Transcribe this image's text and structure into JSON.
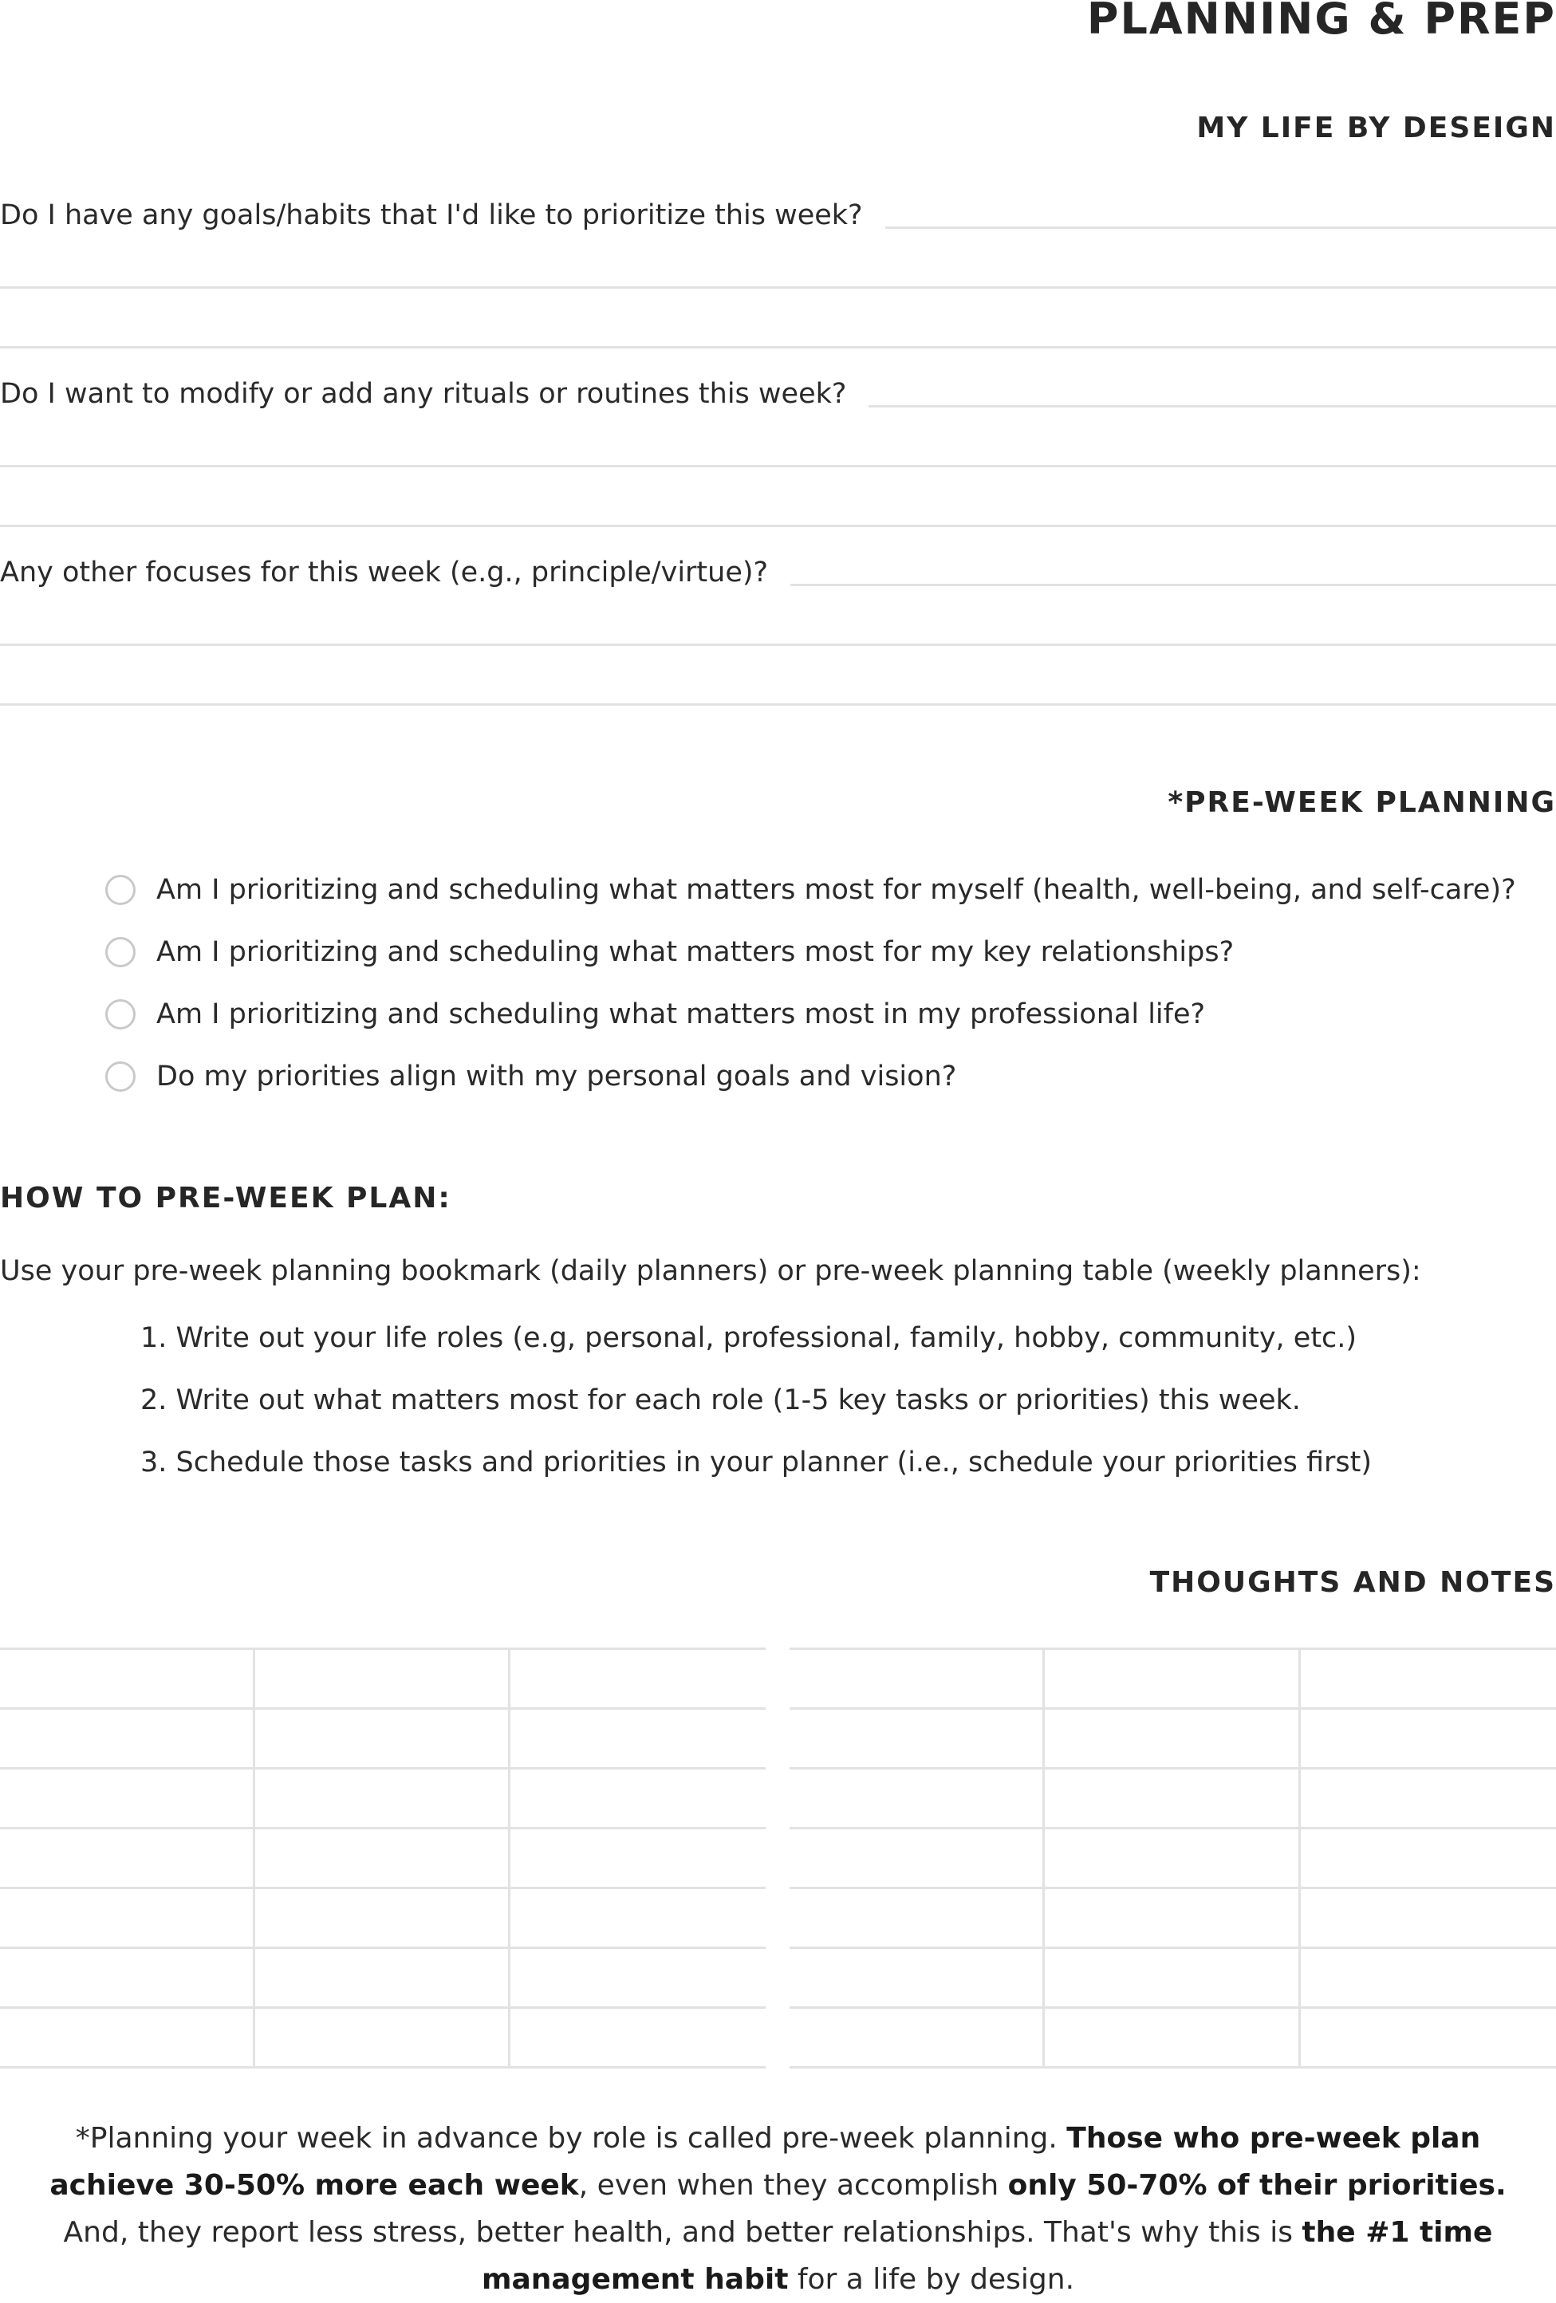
{
  "header": {
    "title": "PLANNING & PREP",
    "subtitle": "MY LIFE BY DESEIGN"
  },
  "questions": [
    "Do I have any goals/habits that I'd like to prioritize this week?",
    "Do I want to modify or add any rituals or routines this week?",
    "Any other focuses for this week (e.g., principle/virtue)?"
  ],
  "pre_week": {
    "heading": "*PRE-WEEK PLANNING",
    "checklist": [
      "Am I prioritizing and scheduling what matters most for myself (health, well-being, and self-care)?",
      "Am I prioritizing and scheduling what matters most for my key relationships?",
      "Am I prioritizing and scheduling what matters most in my professional life?",
      "Do my priorities align with my personal goals and vision?"
    ]
  },
  "how_to": {
    "heading": "HOW TO PRE-WEEK PLAN:",
    "intro": "Use your pre-week planning bookmark (daily planners) or pre-week planning table (weekly planners):",
    "steps": [
      "1. Write out your life roles (e.g, personal, professional, family, hobby, community, etc.)",
      "2. Write out what matters most for each role (1-5 key tasks or priorities) this week.",
      "3. Schedule those tasks and priorities in your planner (i.e., schedule your priorities first)"
    ]
  },
  "notes": {
    "heading": "THOUGHTS AND NOTES"
  },
  "footer": {
    "part1": "*Planning your week in advance by role is called pre-week planning. ",
    "bold1": "Those who pre-week plan achieve 30-50% more each week",
    "part2": ", even when they accomplish ",
    "bold2": "only 50-70% of their priorities.",
    "part3": " And, they report less stress, better health, and better relationships. That's why this is ",
    "bold3": "the #1 time management habit",
    "part4": " for a life by design."
  }
}
